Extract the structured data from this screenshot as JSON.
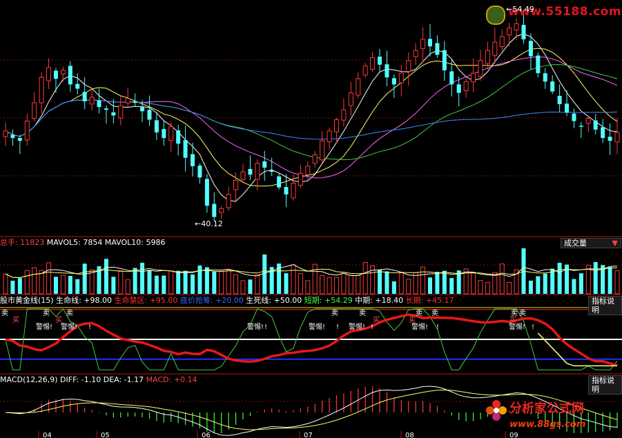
{
  "watermarks": {
    "top_site": "www.55188.com",
    "bottom_brand": "分析家公式网",
    "bottom_site": "www.88gs.com"
  },
  "price_panel": {
    "high_label": "54.49",
    "low_label": "40.12"
  },
  "volume_panel": {
    "header": [
      {
        "text": "总手: ",
        "color": "#ff4040"
      },
      {
        "text": "11823",
        "color": "#ff4040"
      },
      {
        "text": "  MAVOL5: 7854",
        "color": "#ffffff"
      },
      {
        "text": "  MAVOL10: 5986",
        "color": "#ffffff"
      }
    ],
    "selector_label": "成交量"
  },
  "golden_panel": {
    "header": [
      {
        "text": "股市黄金线(15)",
        "color": "#ffffff"
      },
      {
        "text": " 生命线: +98.00",
        "color": "#ffffff"
      },
      {
        "text": "  生命禁区: +95.00",
        "color": "#ff3030"
      },
      {
        "text": "  底价抢筹: +20.00",
        "color": "#4060ff"
      },
      {
        "text": "  生死线: +50.00",
        "color": "#ffffff"
      },
      {
        "text": "  短期: +54.29",
        "color": "#40ff40"
      },
      {
        "text": "  中期: +18.40",
        "color": "#ffffff"
      },
      {
        "text": "  长期: +45.17",
        "color": "#ff3030"
      }
    ],
    "help_label": "指标说明",
    "signal_buy": "买",
    "signal_sell": "卖",
    "signal_warn": "警惕!",
    "signal_bang": "!"
  },
  "macd_panel": {
    "header": [
      {
        "text": "MACD(12,26,9)",
        "color": "#ffffff"
      },
      {
        "text": " DIFF: -1.10",
        "color": "#ffffff"
      },
      {
        "text": " DEA: -1.17",
        "color": "#ffffff"
      },
      {
        "text": " MACD: +0.14",
        "color": "#ff4040"
      }
    ],
    "help_label": "指标说明"
  },
  "x_axis": {
    "ticks": [
      "04",
      "05",
      "06",
      "07",
      "08",
      "09"
    ]
  },
  "colors": {
    "up": "#ff3b3b",
    "down": "#54ffff",
    "ma5": "#ffffff",
    "ma10": "#ffff66",
    "ma20": "#ff66ff",
    "ma30": "#44cc44",
    "ma60": "#4488ff",
    "grid": "#7a1010"
  },
  "chart_data": {
    "type": "candlestick",
    "x_axis_ticks": [
      "04",
      "05",
      "06",
      "07",
      "08",
      "09"
    ],
    "price_annotations": {
      "high": 54.49,
      "low": 40.12
    },
    "close_path": [
      46.5,
      46.0,
      45.8,
      47.2,
      48.5,
      50.3,
      51.0,
      50.2,
      50.8,
      49.8,
      49.5,
      48.6,
      48.9,
      48.2,
      48.0,
      47.6,
      48.3,
      48.8,
      48.5,
      47.9,
      47.3,
      46.4,
      46.0,
      46.8,
      45.6,
      44.6,
      44.0,
      43.2,
      41.2,
      40.4,
      41.0,
      42.0,
      43.0,
      43.6,
      43.4,
      44.2,
      43.9,
      43.6,
      42.5,
      42.0,
      42.8,
      43.5,
      44.0,
      44.8,
      45.8,
      46.5,
      47.3,
      48.0,
      49.2,
      50.2,
      51.1,
      51.7,
      51.2,
      50.3,
      49.8,
      50.6,
      51.5,
      52.2,
      53.0,
      52.5,
      51.9,
      50.8,
      49.8,
      49.2,
      50.0,
      50.6,
      51.5,
      52.2,
      52.8,
      53.2,
      53.8,
      54.1,
      53.0,
      51.8,
      50.6,
      50.0,
      49.3,
      48.4,
      47.8,
      47.2,
      46.8,
      47.4,
      46.6,
      46.0,
      45.8,
      46.4
    ],
    "volume": {
      "last": 11823,
      "mavol5": 7854,
      "mavol10": 5986
    },
    "golden_line_indicator": {
      "name": "股市黄金线(15)",
      "life_line": 98.0,
      "forbidden_zone": 95.0,
      "bottom_buy": 20.0,
      "life_death_line": 50.0,
      "short_term": 54.29,
      "mid_term": 18.4,
      "long_term": 45.17
    },
    "macd": {
      "params": "12,26,9",
      "diff": -1.1,
      "dea": -1.17,
      "macd": 0.14
    }
  }
}
